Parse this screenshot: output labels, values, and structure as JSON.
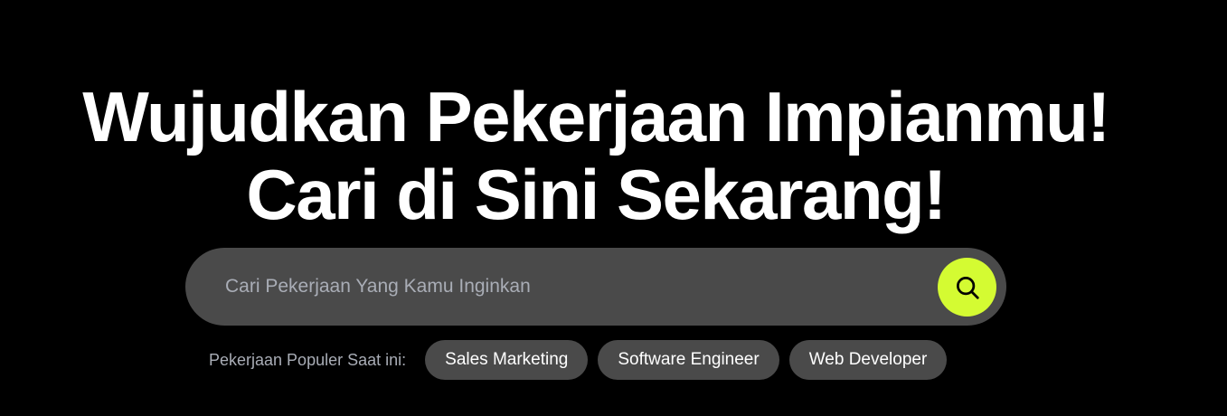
{
  "hero": {
    "headline_line1": "Wujudkan Pekerjaan Impianmu!",
    "headline_line2": "Cari di Sini Sekarang!"
  },
  "search": {
    "placeholder": "Cari Pekerjaan Yang Kamu Inginkan",
    "value": "",
    "button_icon": "search-icon",
    "button_color": "#d4fb32"
  },
  "popular": {
    "label": "Pekerjaan Populer Saat ini:",
    "items": [
      {
        "label": "Sales Marketing"
      },
      {
        "label": "Software Engineer"
      },
      {
        "label": "Web Developer"
      }
    ]
  },
  "colors": {
    "background": "#000000",
    "surface": "#4a4a4a",
    "accent": "#d4fb32",
    "muted_text": "#a9adb6"
  }
}
